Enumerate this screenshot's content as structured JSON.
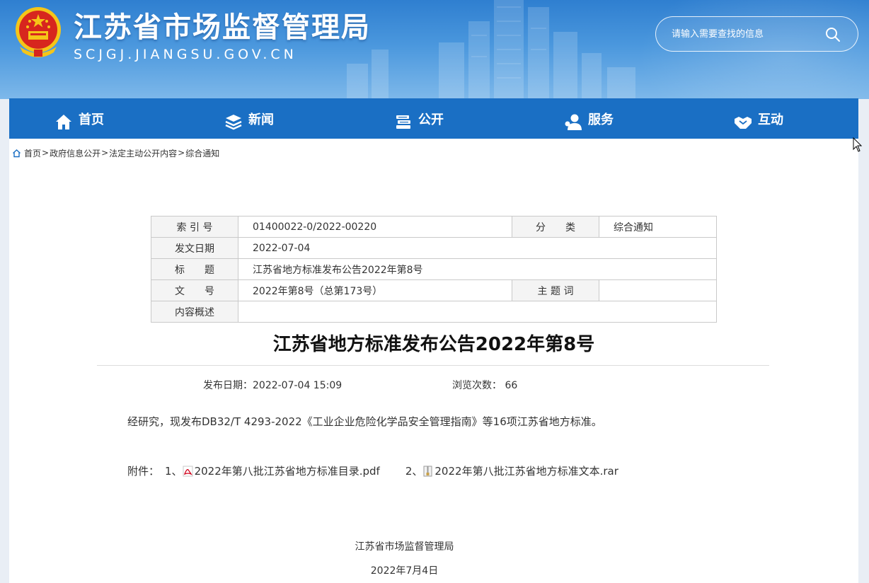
{
  "header": {
    "title": "江苏省市场监督管理局",
    "domain": "SCJGJ.JIANGSU.GOV.CN",
    "search_placeholder": "请输入需要查找的信息",
    "emblem_icon": "national-emblem-icon",
    "search_icon": "search-icon",
    "colors": {
      "header_top": "#2f7fd0",
      "header_bottom": "#7db8ea",
      "emblem_red": "#d7261e",
      "emblem_gold": "#f5c518"
    }
  },
  "nav": {
    "color": "#1a6fc4",
    "items": [
      {
        "label": "首页",
        "icon": "home-icon"
      },
      {
        "label": "新闻",
        "icon": "layers-icon"
      },
      {
        "label": "公开",
        "icon": "books-icon"
      },
      {
        "label": "服务",
        "icon": "user-service-icon"
      },
      {
        "label": "互动",
        "icon": "handshake-icon"
      }
    ]
  },
  "breadcrumb": {
    "icon": "home-outline-icon",
    "items": [
      "首页",
      "政府信息公开",
      "法定主动公开内容",
      "综合通知"
    ],
    "separator": ">"
  },
  "meta": {
    "index_label": "索 引 号",
    "index_value": "01400022-0/2022-00220",
    "category_label": "分　　类",
    "category_value": "综合通知",
    "date_label": "发文日期",
    "date_value": "2022-07-04",
    "title_label": "标　　题",
    "title_value": "江苏省地方标准发布公告2022年第8号",
    "docno_label": "文　　号",
    "docno_value": "2022年第8号（总第173号）",
    "keyword_label": "主 题 词",
    "keyword_value": "",
    "summary_label": "内容概述",
    "summary_value": ""
  },
  "article": {
    "title": "江苏省地方标准发布公告2022年第8号",
    "publish_date": "发布日期：2022-07-04 15:09",
    "views": "浏览次数： 66",
    "body": "经研究，现发布DB32/T 4293-2022《工业企业危险化学品安全管理指南》等16项江苏省地方标准。",
    "attach_label": "附件：",
    "attachments": [
      {
        "index": "1、",
        "name": "2022年第八批江苏省地方标准目录.pdf",
        "icon": "pdf-icon"
      },
      {
        "index": "2、",
        "name": "2022年第八批江苏省地方标准文本.rar",
        "icon": "archive-icon"
      }
    ],
    "signature": "江苏省市场监督管理局",
    "sign_date": "2022年7月4日"
  }
}
